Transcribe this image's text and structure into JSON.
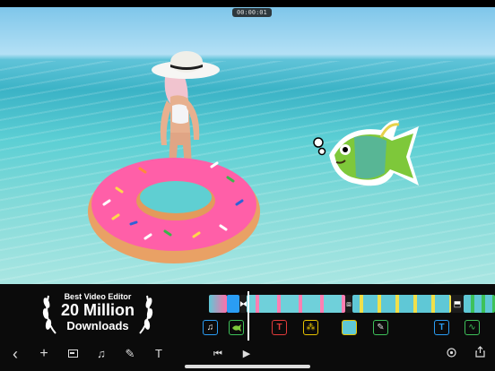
{
  "preview": {
    "timestamp": "00:00:01"
  },
  "badge": {
    "line1": "Best Video Editor",
    "line2": "20 Million",
    "line3": "Downloads"
  },
  "timeline": {
    "clip_icons": [
      "music-note-icon",
      "fish-sticker-icon",
      "text-T-icon",
      "footprints-sticker-icon",
      "photo-icon",
      "pen-icon",
      "text-T-icon",
      "audio-wave-icon"
    ]
  },
  "toolbar": {
    "back": "‹",
    "add": "+",
    "text_tool": "T",
    "skip_back": "⏮",
    "play": "▶"
  },
  "colors": {
    "accent_blue": "#2a9df4",
    "accent_red": "#e23b3b",
    "accent_yellow": "#e6c200",
    "accent_green": "#3ec15a"
  }
}
